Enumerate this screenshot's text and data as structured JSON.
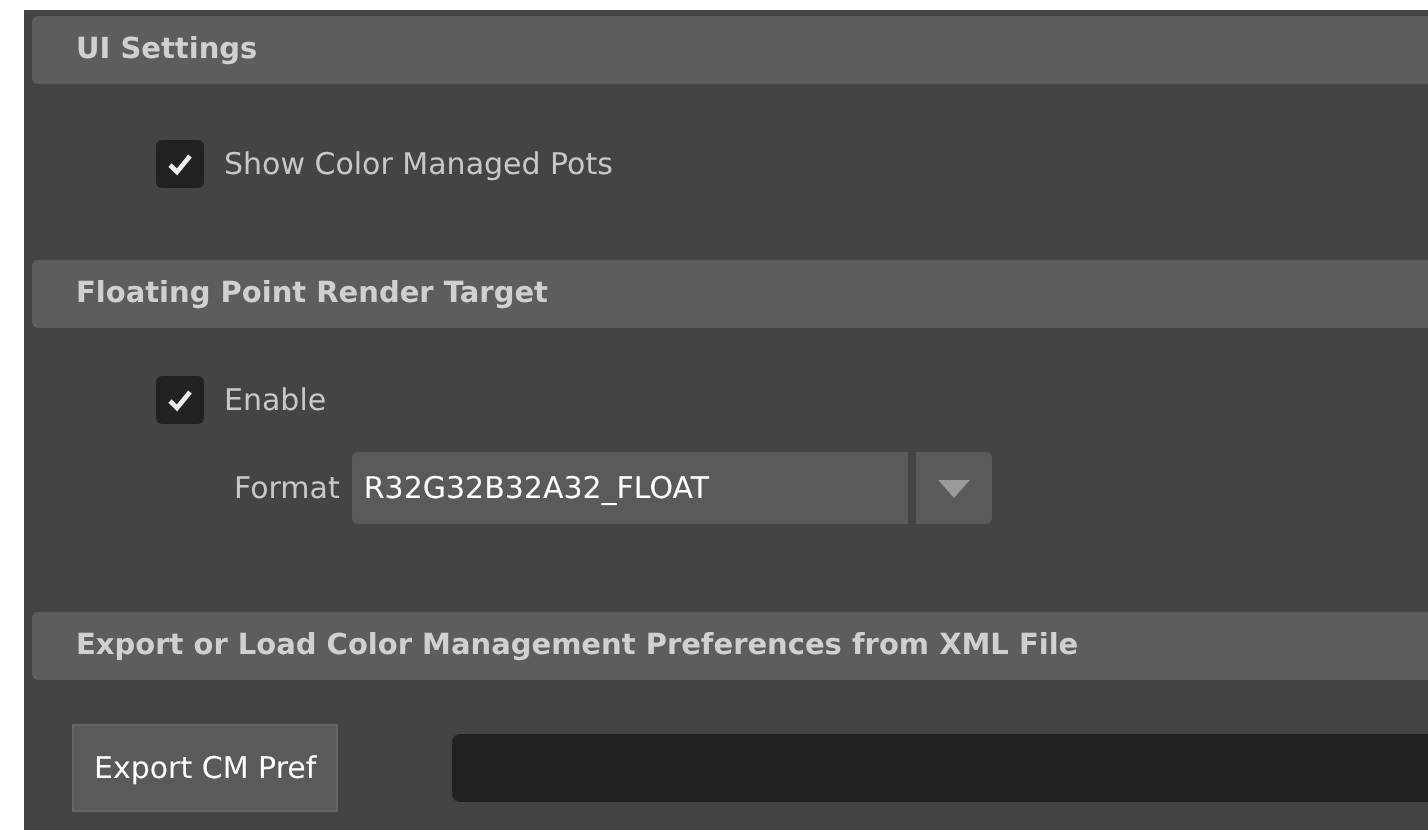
{
  "sections": [
    {
      "title": "UI Settings",
      "rows": [
        {
          "kind": "checkbox",
          "label": "Show Color Managed Pots",
          "checked": true
        }
      ]
    },
    {
      "title": "Floating Point Render Target",
      "rows": [
        {
          "kind": "checkbox",
          "label": "Enable",
          "checked": true
        },
        {
          "kind": "dropdown",
          "label": "Format",
          "value": "R32G32B32A32_FLOAT"
        }
      ]
    },
    {
      "title": "Export or Load Color Management Preferences from XML File",
      "rows": [
        {
          "kind": "button-field",
          "button": "Export CM Pref"
        }
      ]
    }
  ]
}
